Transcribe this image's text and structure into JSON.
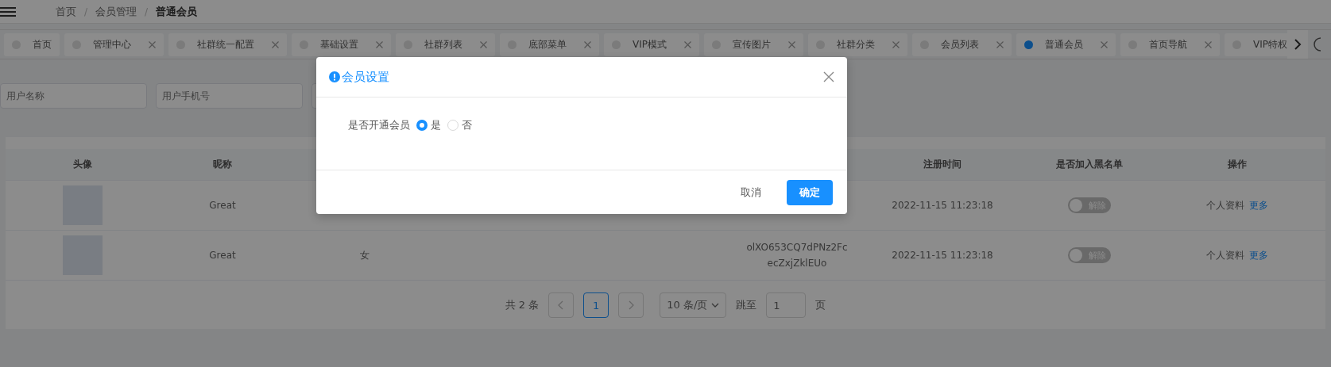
{
  "breadcrumb": {
    "separator": "/",
    "items": [
      "首页",
      "会员管理",
      "普通会员"
    ]
  },
  "tabs": [
    {
      "label": "首页",
      "selected": false,
      "closable": false
    },
    {
      "label": "管理中心",
      "selected": false,
      "closable": true
    },
    {
      "label": "社群统一配置",
      "selected": false,
      "closable": true
    },
    {
      "label": "基础设置",
      "selected": false,
      "closable": true
    },
    {
      "label": "社群列表",
      "selected": false,
      "closable": true
    },
    {
      "label": "底部菜单",
      "selected": false,
      "closable": true
    },
    {
      "label": "VIP模式",
      "selected": false,
      "closable": true
    },
    {
      "label": "宣传图片",
      "selected": false,
      "closable": true
    },
    {
      "label": "社群分类",
      "selected": false,
      "closable": true
    },
    {
      "label": "会员列表",
      "selected": false,
      "closable": true
    },
    {
      "label": "普通会员",
      "selected": true,
      "closable": true
    },
    {
      "label": "首页导航",
      "selected": false,
      "closable": true
    },
    {
      "label": "VIP特权",
      "selected": false,
      "closable": false
    }
  ],
  "search_fields": [
    {
      "placeholder": "用户名称"
    },
    {
      "placeholder": "用户手机号"
    }
  ],
  "table": {
    "columns": [
      {
        "label": "头像"
      },
      {
        "label": "昵称"
      },
      {},
      {},
      {
        "label": "注册时间"
      },
      {
        "label": "是否加入黑名单"
      },
      {
        "label": "操作"
      }
    ],
    "rows": [
      {
        "nickname": "Great",
        "registered": "2022-11-15 11:23:18",
        "blacklist": {
          "on": false,
          "label": "解除"
        },
        "actions": [
          "个人资料",
          "更多"
        ]
      },
      {
        "nickname": "Great",
        "gender": "女",
        "openid": [
          "olXO653CQ7dPNz2Fc",
          "ecZxjZklEUo"
        ],
        "registered": "2022-11-15 11:23:18",
        "blacklist": {
          "on": false,
          "label": "解除"
        },
        "actions": [
          "个人资料",
          "更多"
        ]
      }
    ]
  },
  "pagination": {
    "total": "共 2 条",
    "pages": [
      {
        "label": "1",
        "selected": true
      }
    ],
    "page_size": "10 条/页",
    "jump_label": "跳至",
    "jump_value": "1",
    "page_unit": "页"
  },
  "dialog": {
    "title": "会员设置",
    "field_label": "是否开通会员",
    "options": [
      {
        "label": "是",
        "selected": true
      },
      {
        "label": "否",
        "selected": false
      }
    ],
    "buttons": [
      {
        "label": "取消",
        "kind": "plain"
      },
      {
        "label": "确定",
        "kind": "primary"
      }
    ]
  }
}
